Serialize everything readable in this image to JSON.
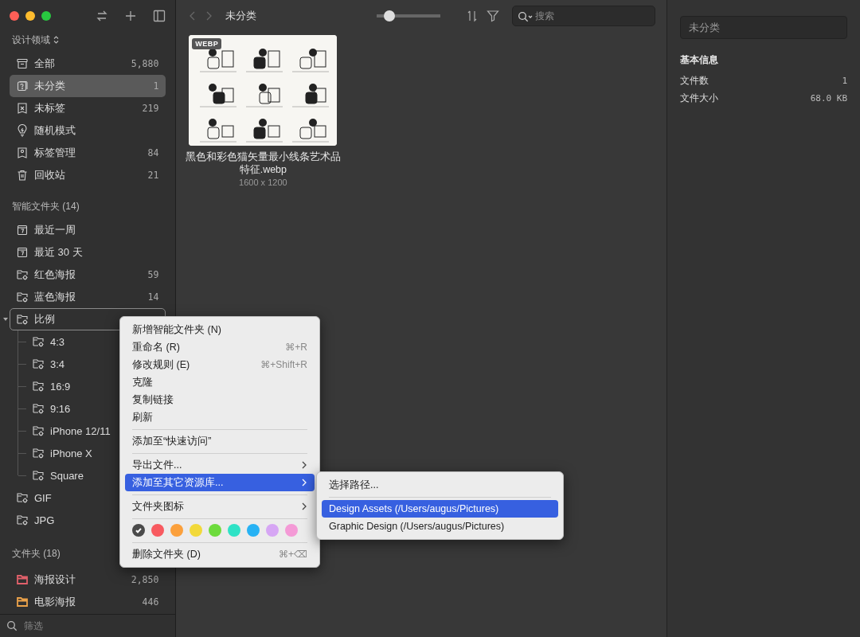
{
  "sidebar": {
    "library_header": "设计领域",
    "library": [
      {
        "label": "全部",
        "count": "5,880",
        "selected": false
      },
      {
        "label": "未分类",
        "count": "1",
        "selected": true
      },
      {
        "label": "未标签",
        "count": "219",
        "selected": false
      },
      {
        "label": "随机模式",
        "selected": false
      },
      {
        "label": "标签管理",
        "count": "84",
        "selected": false
      },
      {
        "label": "回收站",
        "count": "21",
        "selected": false
      }
    ],
    "smart_header": "智能文件夹 (14)",
    "smart_folders": [
      {
        "kind": "calendar",
        "label": "最近一周",
        "selected": false,
        "outlined": false
      },
      {
        "kind": "calendar",
        "label": "最近 30 天",
        "selected": false,
        "outlined": false
      },
      {
        "kind": "smart",
        "label": "红色海报",
        "count": "59",
        "selected": false,
        "outlined": false
      },
      {
        "kind": "smart",
        "label": "蓝色海报",
        "count": "14",
        "selected": false,
        "outlined": false
      },
      {
        "kind": "smart",
        "label": "比例",
        "selected": false,
        "outlined": true,
        "expanded": true,
        "children": [
          {
            "kind": "smart",
            "label": "4:3",
            "selected": false,
            "outlined": false
          },
          {
            "kind": "smart",
            "label": "3:4",
            "selected": false,
            "outlined": false
          },
          {
            "kind": "smart",
            "label": "16:9",
            "selected": false,
            "outlined": false
          },
          {
            "kind": "smart",
            "label": "9:16",
            "selected": false,
            "outlined": false
          },
          {
            "kind": "smart",
            "label": "iPhone 12/11",
            "selected": false,
            "outlined": false
          },
          {
            "kind": "smart",
            "label": "iPhone X",
            "selected": false,
            "outlined": false
          },
          {
            "kind": "smart",
            "label": "Square",
            "selected": false,
            "outlined": false
          }
        ]
      },
      {
        "kind": "smart",
        "label": "GIF",
        "selected": false,
        "outlined": false
      },
      {
        "kind": "smart",
        "label": "JPG",
        "selected": false,
        "outlined": false
      }
    ],
    "folders_header": "文件夹 (18)",
    "folders": [
      {
        "label": "海报设计",
        "count": "2,850",
        "color": "#e0606a",
        "selected": false
      },
      {
        "label": "电影海报",
        "count": "446",
        "color": "#eba24a",
        "selected": false
      }
    ],
    "filter": {
      "placeholder": "筛选"
    }
  },
  "toolbar": {
    "title": "未分类",
    "zoom": {
      "level": 0.2
    },
    "search": {
      "placeholder": "搜索"
    }
  },
  "items": [
    {
      "kind": "picture",
      "badge": "WEBP",
      "name": "黑色和彩色猫矢量最小线条艺术品特征.webp",
      "size": "1600 x 1200"
    }
  ],
  "inspector": {
    "name": "未分类",
    "section": "基本信息",
    "rows": [
      {
        "label": "文件数",
        "value": "1"
      },
      {
        "label": "文件大小",
        "value": "68.0 KB"
      }
    ]
  },
  "context_menu": {
    "items": [
      {
        "kind": "item",
        "label": "新增智能文件夹 (N)",
        "selected": false
      },
      {
        "kind": "item",
        "label": "重命名 (R)",
        "shortcut": "⌘+R",
        "selected": false
      },
      {
        "kind": "item",
        "label": "修改规则 (E)",
        "shortcut": "⌘+Shift+R",
        "selected": false
      },
      {
        "kind": "item",
        "label": "克隆",
        "selected": false
      },
      {
        "kind": "item",
        "label": "复制链接",
        "selected": false
      },
      {
        "kind": "item",
        "label": "刷新",
        "selected": false
      },
      {
        "kind": "separator"
      },
      {
        "kind": "item",
        "label": "添加至“快速访问”",
        "selected": false
      },
      {
        "kind": "separator"
      },
      {
        "kind": "item",
        "label": "导出文件...",
        "submenu": true,
        "selected": false
      },
      {
        "kind": "item",
        "label": "添加至其它资源库...",
        "submenu": true,
        "selected": true
      },
      {
        "kind": "separator"
      },
      {
        "kind": "item",
        "label": "文件夹图标",
        "submenu": true,
        "selected": false
      },
      {
        "kind": "separator"
      },
      {
        "kind": "colors",
        "colors": [
          {
            "color": "#4a4a4a",
            "selected": true
          },
          {
            "color": "#f85a60",
            "selected": false
          },
          {
            "color": "#fba03c",
            "selected": false
          },
          {
            "color": "#f2d93a",
            "selected": false
          },
          {
            "color": "#6ddb3c",
            "selected": false
          },
          {
            "color": "#2fe2c6",
            "selected": false
          },
          {
            "color": "#27b2f4",
            "selected": false
          },
          {
            "color": "#d6a6f4",
            "selected": false
          },
          {
            "color": "#f49ad6",
            "selected": false
          }
        ]
      },
      {
        "kind": "separator"
      },
      {
        "kind": "item",
        "label": "删除文件夹 (D)",
        "shortcut": "⌘+⌫",
        "selected": false
      }
    ]
  },
  "submenu": {
    "items": [
      {
        "kind": "item",
        "label": "选择路径...",
        "selected": false
      },
      {
        "kind": "separator"
      },
      {
        "kind": "item",
        "label": "Design Assets (/Users/augus/Pictures)",
        "selected": true
      },
      {
        "kind": "item",
        "label": "Graphic Design (/Users/augus/Pictures)",
        "selected": false
      }
    ]
  }
}
